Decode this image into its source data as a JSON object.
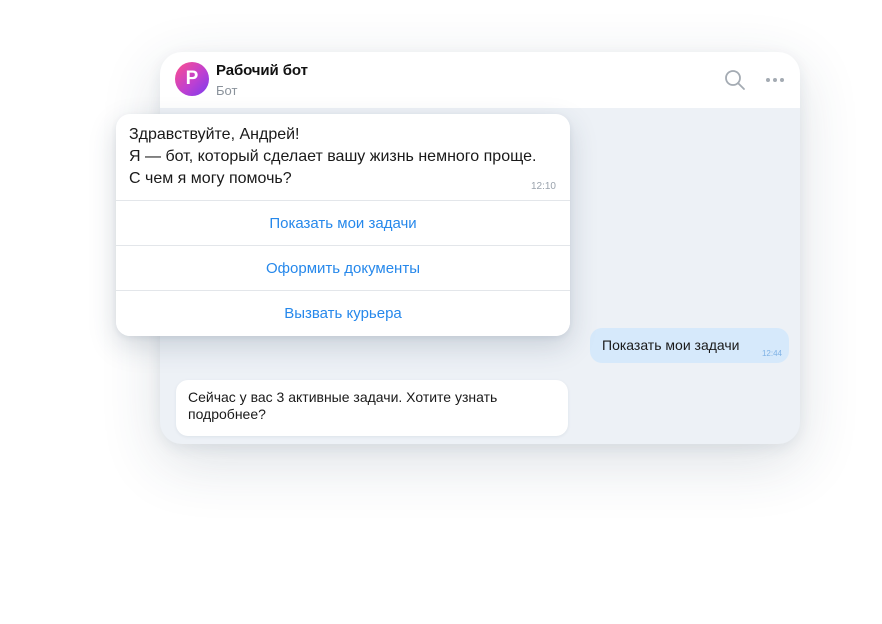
{
  "header": {
    "avatar_letter": "Р",
    "title": "Рабочий бот",
    "subtitle": "Бот",
    "icons": [
      "search-icon",
      "more-icon"
    ]
  },
  "greeting": {
    "lines": [
      "Здравствуйте, Андрей!",
      "Я — бот, который сделает вашу жизнь немного проще.",
      "С чем я могу помочь?"
    ],
    "time": "12:10"
  },
  "keyboard": {
    "buttons": [
      "Показать мои задачи",
      "Оформить документы",
      "Вызвать курьера"
    ]
  },
  "outgoing": {
    "text": "Показать мои задачи",
    "time": "12:44"
  },
  "incoming": {
    "text": "Сейчас у вас 3 активные задачи. Хотите узнать подробнее?"
  },
  "colors": {
    "accent": "#2688eb",
    "outgoing_bubble": "#d6e9fb",
    "chat_background": "#edf1f6"
  }
}
